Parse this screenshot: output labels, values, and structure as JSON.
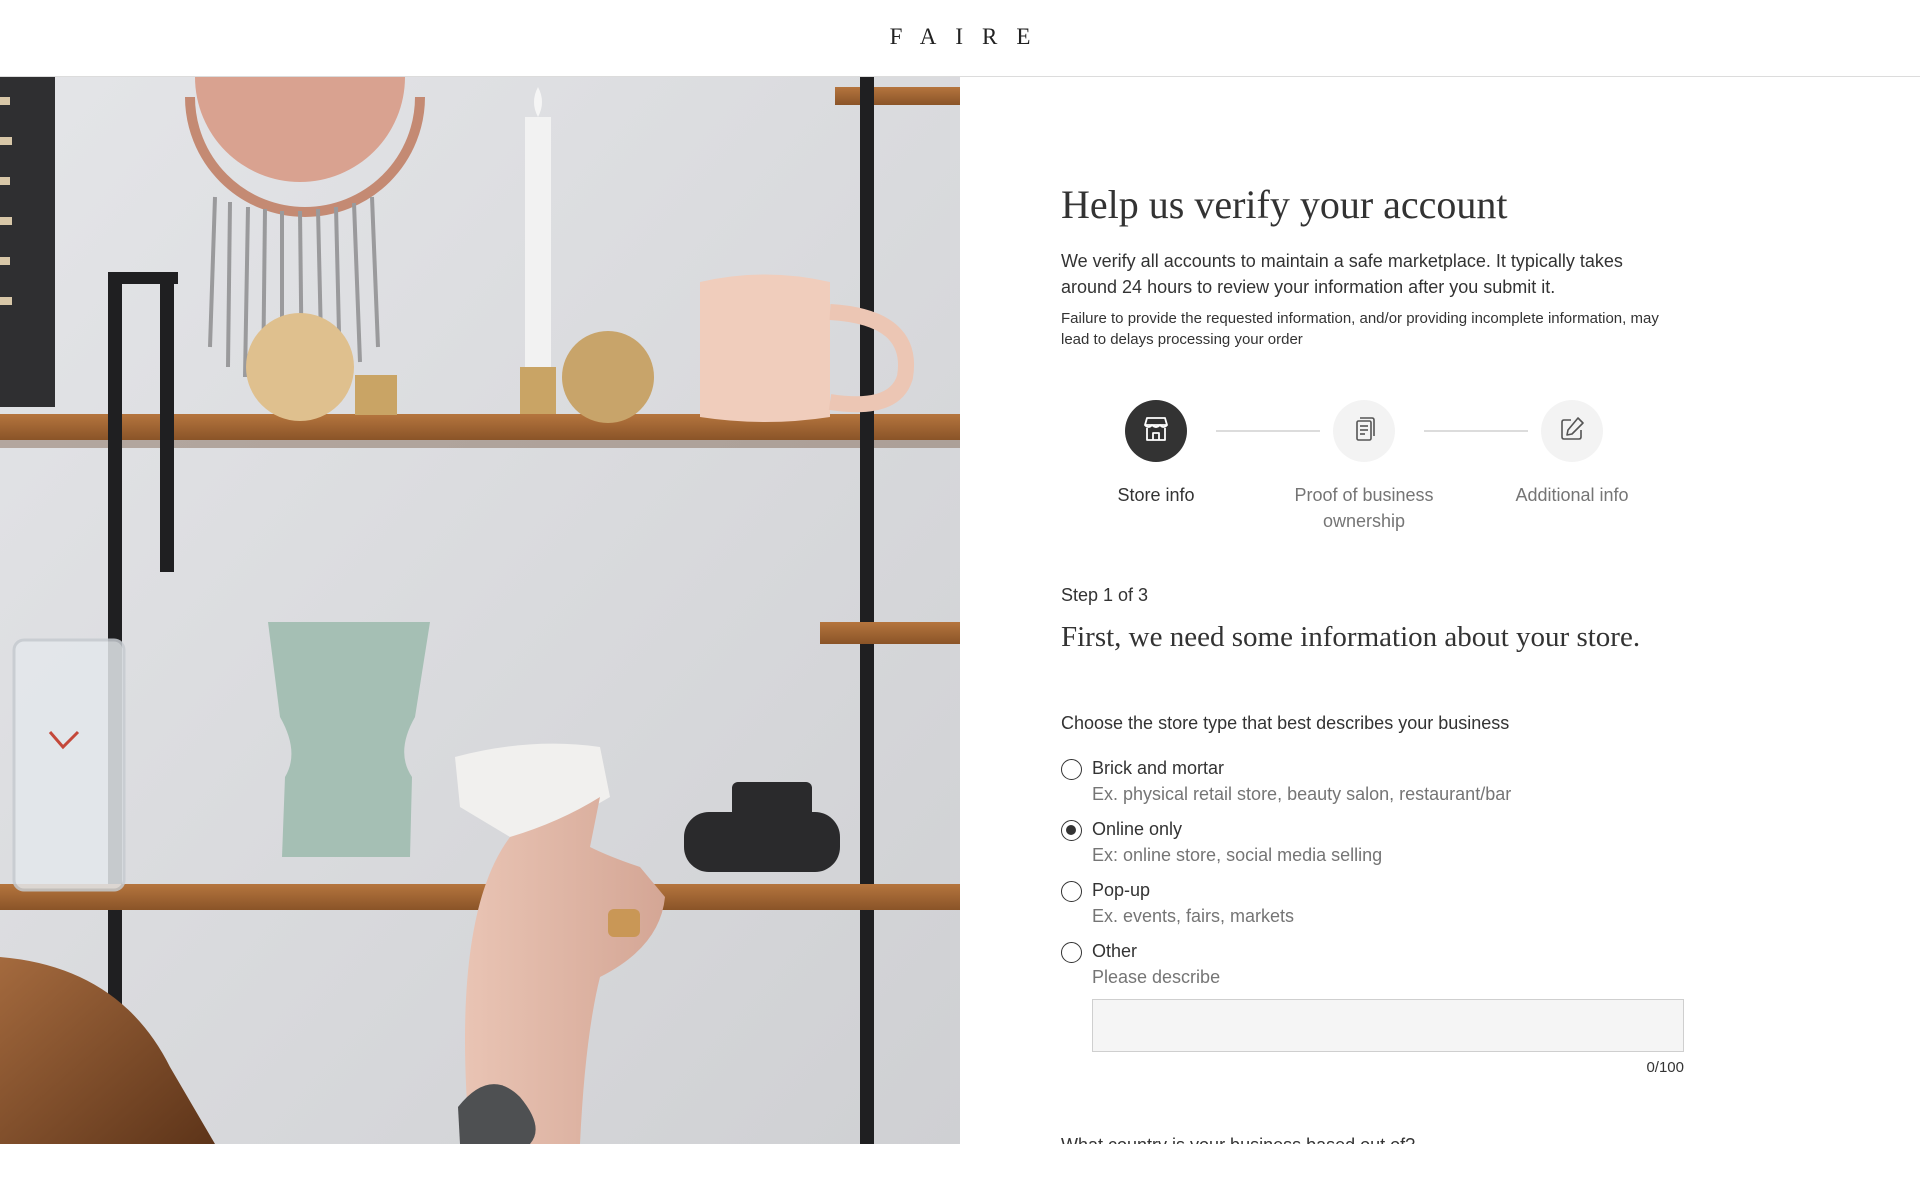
{
  "header": {
    "logo": "FAIRE"
  },
  "hero": {
    "alt": "Person holding a white ceramic vase in front of wooden shelves with pottery"
  },
  "page": {
    "title": "Help us verify your account",
    "intro": "We verify all accounts to maintain a safe marketplace. It typically takes around 24 hours to review your information after you submit it.",
    "note": "Failure to provide the requested information, and/or providing incomplete information, may lead to delays processing your order"
  },
  "stepper": {
    "steps": [
      {
        "label": "Store info",
        "icon": "storefront-icon",
        "active": true
      },
      {
        "label": "Proof of business ownership",
        "icon": "document-icon",
        "active": false
      },
      {
        "label": "Additional info",
        "icon": "edit-icon",
        "active": false
      }
    ]
  },
  "form": {
    "step_count": "Step 1 of 3",
    "subtitle": "First, we need some information about your store.",
    "question": "Choose the store type that best describes your business",
    "options": [
      {
        "label": "Brick and mortar",
        "description": "Ex. physical retail store, beauty salon, restaurant/bar",
        "selected": false
      },
      {
        "label": "Online only",
        "description": "Ex: online store, social media selling",
        "selected": true
      },
      {
        "label": "Pop-up",
        "description": "Ex. events, fairs, markets",
        "selected": false
      },
      {
        "label": "Other",
        "description": "Please describe",
        "selected": false
      }
    ],
    "other_value": "",
    "counter": "0/100",
    "next_question": "What country is your business based out of?"
  },
  "colors": {
    "primary": "#333333",
    "muted": "#757575",
    "divider": "#dcdcdc",
    "input_bg": "#f5f5f5"
  }
}
